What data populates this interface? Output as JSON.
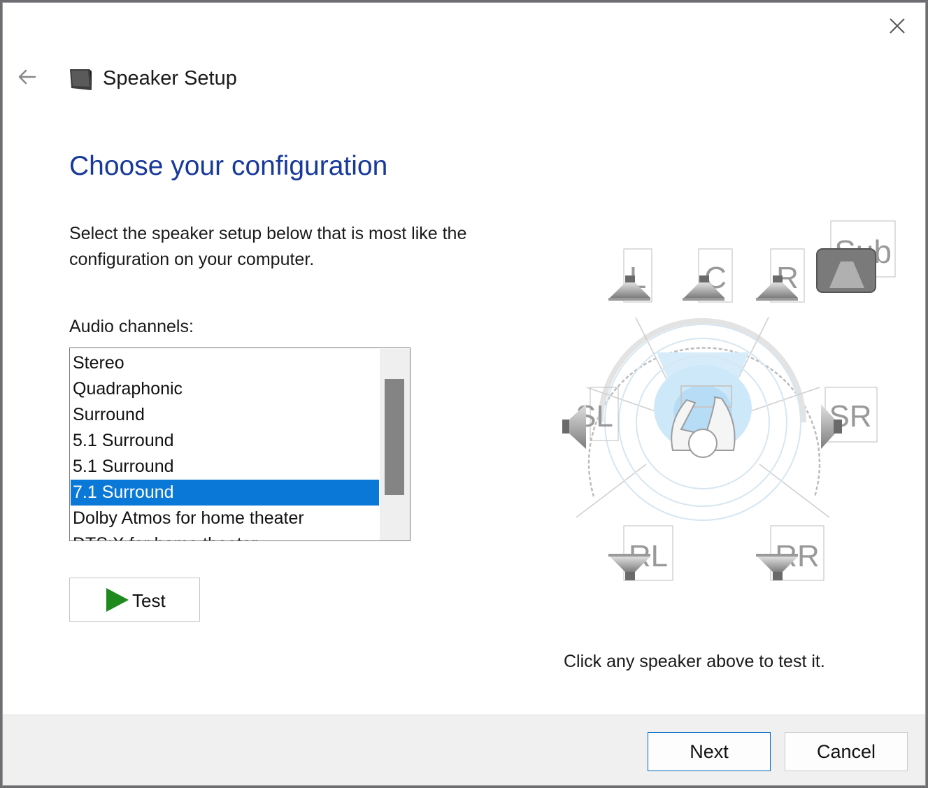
{
  "window": {
    "title": "Speaker Setup",
    "icons": {
      "close": "close-icon",
      "back": "back-arrow-icon",
      "app": "speaker-icon"
    }
  },
  "heading": "Choose your configuration",
  "description": "Select the speaker setup below that is most like the configuration on your computer.",
  "channels": {
    "label": "Audio channels:",
    "items": [
      "Stereo",
      "Quadraphonic",
      "Surround",
      "5.1 Surround",
      "5.1 Surround",
      "7.1 Surround",
      "Dolby Atmos for home theater",
      "DTS:X for home theater"
    ],
    "selected": "7.1 Surround"
  },
  "test_button": {
    "label": "Test",
    "icon": "play-icon"
  },
  "speakers": {
    "front_left": "L",
    "center": "C",
    "front_right": "R",
    "subwoofer": "Sub",
    "side_left": "SL",
    "side_right": "SR",
    "rear_left": "RL",
    "rear_right": "RR"
  },
  "hint": "Click any speaker above to test it.",
  "footer": {
    "next_label": "Next",
    "cancel_label": "Cancel"
  },
  "colors": {
    "accent": "#0a78d7",
    "heading": "#17399a",
    "play": "#1e8a1e"
  }
}
